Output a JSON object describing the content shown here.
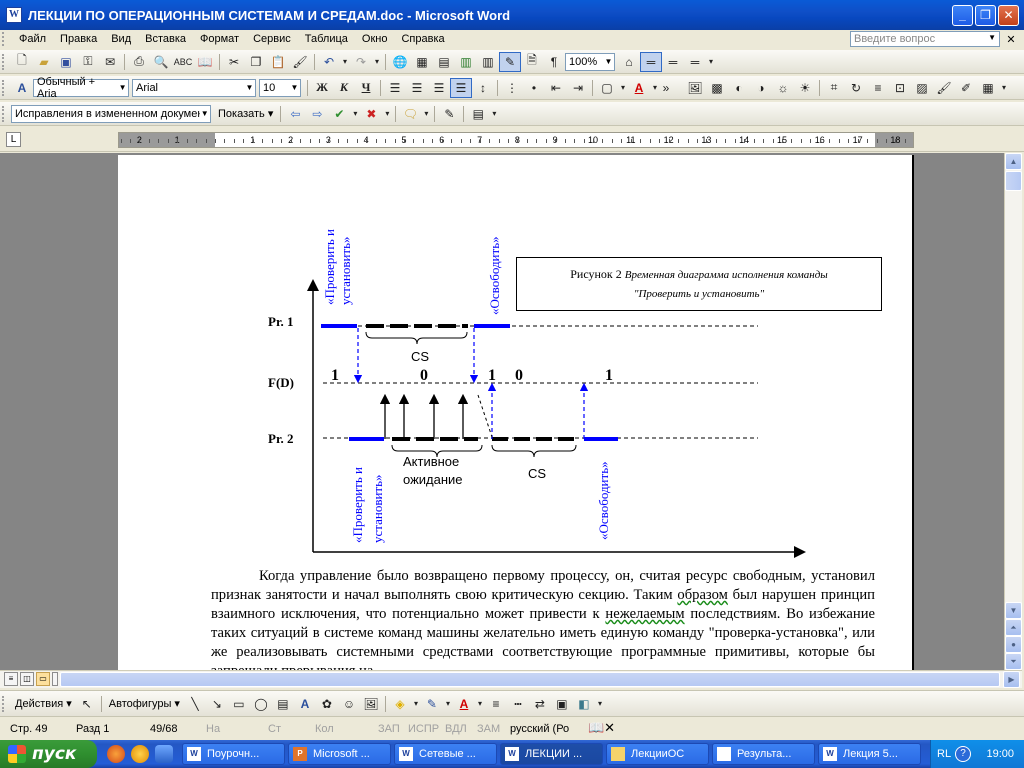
{
  "window": {
    "title": "ЛЕКЦИИ ПО ОПЕРАЦИОННЫМ СИСТЕМАМ И СРЕДАМ.doc - Microsoft Word"
  },
  "menu": {
    "items": [
      "Файл",
      "Правка",
      "Вид",
      "Вставка",
      "Формат",
      "Сервис",
      "Таблица",
      "Окно",
      "Справка"
    ],
    "ask_placeholder": "Введите вопрос"
  },
  "format_toolbar": {
    "style": "Обычный + Aria",
    "font": "Arial",
    "size": "10",
    "bold": "Ж",
    "italic": "К",
    "underline": "Ч"
  },
  "standard_toolbar": {
    "zoom": "100%"
  },
  "review_toolbar": {
    "mode": "Исправления в измененном документ",
    "show": "Показать"
  },
  "ruler": {
    "numbers": [
      "2",
      "1",
      "1",
      "2",
      "3",
      "4",
      "5",
      "6",
      "7",
      "8",
      "9",
      "10",
      "11",
      "12",
      "13",
      "14",
      "15",
      "16",
      "17",
      "18"
    ]
  },
  "figure": {
    "caption_prefix": "Рисунок 2",
    "caption_text": "Временная диаграмма исполнения команды",
    "caption_text2": "\"Проверить и установить\"",
    "rows": {
      "pr1": "Pr. 1",
      "fd": "F(D)",
      "pr2": "Pr. 2"
    },
    "fd_values": [
      "1",
      "0",
      "1",
      "0",
      "1"
    ],
    "labels": {
      "check_set_top_1": "«Проверить и",
      "check_set_top_2": "установить»",
      "release_top": "«Освободить»",
      "cs_top": "CS",
      "active_wait_1": "Активное",
      "active_wait_2": "ожидание",
      "cs_bottom": "CS",
      "check_set_bottom_1": "«Проверить и",
      "check_set_bottom_2": "установить»",
      "release_bottom": "«Освободить»"
    }
  },
  "paragraph": {
    "text_1": "Когда управление было возвращено первому процессу, он, считая ресурс свободным, установил признак занятости и начал выполнять свою критическую секцию. Таким ",
    "word_2": "образом",
    "text_3": " был нарушен принцип взаимного исключения, что потенциально может привести к ",
    "word_4": "нежелаемым",
    "text_5": " последствиям. Во избежание таких ситуаций в системе команд машины желательно иметь единую команду \"проверка-установка\", или же реализовывать системными средствами соответствующие программные примитивы, которые бы запрещали прерывания на"
  },
  "drawing_toolbar": {
    "actions": "Действия",
    "autoshapes": "Автофигуры"
  },
  "status": {
    "page": "Стр.  49",
    "section": "Разд  1",
    "pages": "49/68",
    "at": "На",
    "line": "Ст",
    "col": "Кол",
    "rec": "ЗАП",
    "trk": "ИСПР",
    "ext": "ВДЛ",
    "ovr": "ЗАМ",
    "language": "русский (Ро"
  },
  "taskbar": {
    "start": "пуск",
    "tasks": [
      {
        "label": "Поурочн...",
        "active": false
      },
      {
        "label": "Microsoft ...",
        "active": false
      },
      {
        "label": "Сетевые ...",
        "active": false
      },
      {
        "label": "ЛЕКЦИИ ...",
        "active": true
      },
      {
        "label": "ЛекцииОС",
        "active": false
      },
      {
        "label": "Результа...",
        "active": false
      },
      {
        "label": "Лекция 5...",
        "active": false
      }
    ],
    "lang": "RL",
    "clock": "19:00"
  },
  "colors": {
    "accent_blue": "#0000ff",
    "titlebar": "#0a5bd6",
    "taskbar": "#245dd6",
    "start": "#3a9b3a"
  }
}
